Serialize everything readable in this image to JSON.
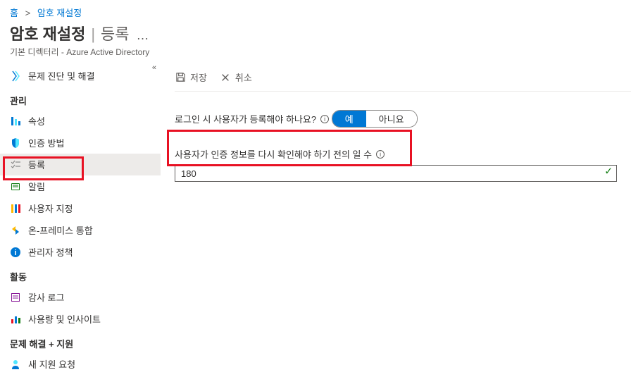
{
  "breadcrumb": {
    "home": "홈",
    "current": "암호 재설정"
  },
  "header": {
    "title": "암호 재설정",
    "subtitle_tab": "등록",
    "more": "…",
    "subtext": "기본 디렉터리 - Azure Active Directory"
  },
  "toolbar": {
    "save": "저장",
    "discard": "취소"
  },
  "sidebar": {
    "diagnose": "문제 진단 및 해결",
    "sections": {
      "manage": "관리",
      "activity": "활동",
      "support": "문제 해결 + 지원"
    },
    "items": {
      "properties": "속성",
      "auth_methods": "인증 방법",
      "registration": "등록",
      "notifications": "알림",
      "customization": "사용자 지정",
      "onprem": "온-프레미스 통합",
      "admin_policy": "관리자 정책",
      "audit_logs": "감사 로그",
      "usage_insights": "사용량 및 인사이트",
      "new_support": "새 지원 요청"
    }
  },
  "content": {
    "require_register_label": "로그인 시 사용자가 등록해야 하나요?",
    "toggle_yes": "예",
    "toggle_no": "아니요",
    "days_label": "사용자가 인증 정보를 다시 확인해야 하기 전의 일 수",
    "days_value": "180"
  }
}
